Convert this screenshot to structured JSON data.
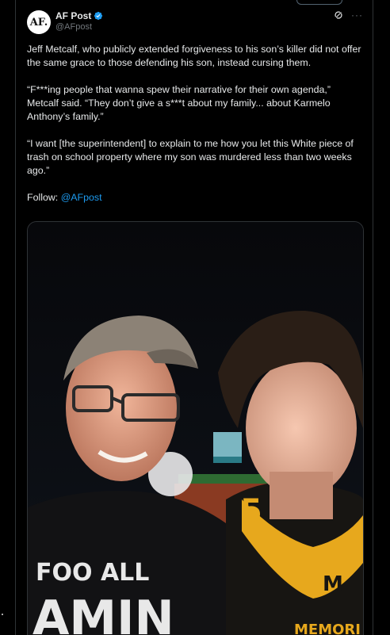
{
  "tweet": {
    "author_name": "AF Post",
    "author_handle": "@AFpost",
    "avatar_text": "AF.",
    "paragraphs": [
      "Jeff Metcalf, who publicly extended forgiveness to his son’s killer did not offer the same grace to those defending his son, instead cursing them.",
      "“F***ing people that wanna spew their narrative for their own agenda,” Metcalf said. “They don’t give a s***t about my family... about Karmelo Anthony’s family.”",
      "“I want [the superintendent] to explain to me how you let this White piece of trash on school property where my son was murdered less than two weeks ago.”"
    ],
    "follow_label": "Follow:",
    "follow_handle": "@AFpost",
    "verified_icon": "verified-badge-icon",
    "grok_icon": "grok-icon",
    "more_icon": "more-options-icon",
    "image": {
      "shirt_text_top": "FOO  ALL",
      "shirt_text_bottom": "AMIN",
      "jersey_letter": "M",
      "jersey_text": "MEMORI",
      "jersey_number": "5"
    },
    "colors": {
      "accent": "#1d9bf0",
      "background": "#000000",
      "text": "#e7e9ea",
      "muted": "#71767b",
      "jersey_gold": "#e7a81d"
    }
  }
}
